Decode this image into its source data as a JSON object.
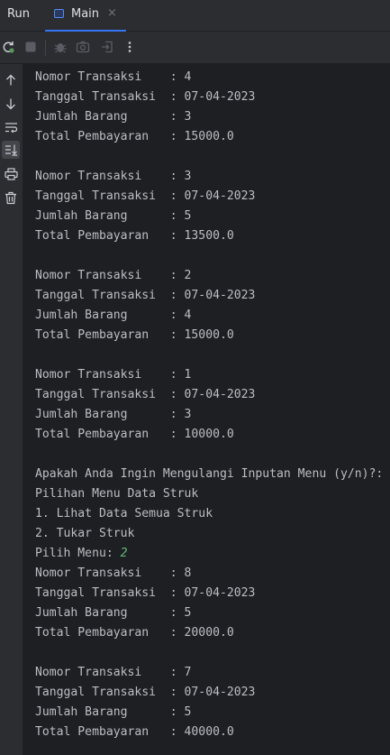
{
  "tabbar": {
    "run_label": "Run",
    "tab_label": "Main",
    "close_glyph": "×"
  },
  "toolbar": {
    "buttons": [
      "rerun-icon",
      "stop-icon",
      "debug-icon",
      "screenshot-icon",
      "exit-icon",
      "more-icon"
    ]
  },
  "sidebar": {
    "buttons": [
      "arrow-up-icon",
      "arrow-down-icon",
      "soft-wrap-icon",
      "scroll-to-end-icon",
      "print-icon",
      "trash-icon"
    ]
  },
  "colors": {
    "accent": "#3574f0",
    "console_text": "#bcbec4",
    "user_input": "#5fb87a",
    "background": "#1e1f22",
    "panel": "#2b2d30"
  },
  "console": {
    "lines": [
      {
        "text": "Nomor Transaksi    : 4"
      },
      {
        "text": "Tanggal Transaksi  : 07-04-2023"
      },
      {
        "text": "Jumlah Barang      : 3"
      },
      {
        "text": "Total Pembayaran   : 15000.0"
      },
      {
        "text": ""
      },
      {
        "text": "Nomor Transaksi    : 3"
      },
      {
        "text": "Tanggal Transaksi  : 07-04-2023"
      },
      {
        "text": "Jumlah Barang      : 5"
      },
      {
        "text": "Total Pembayaran   : 13500.0"
      },
      {
        "text": ""
      },
      {
        "text": "Nomor Transaksi    : 2"
      },
      {
        "text": "Tanggal Transaksi  : 07-04-2023"
      },
      {
        "text": "Jumlah Barang      : 4"
      },
      {
        "text": "Total Pembayaran   : 15000.0"
      },
      {
        "text": ""
      },
      {
        "text": "Nomor Transaksi    : 1"
      },
      {
        "text": "Tanggal Transaksi  : 07-04-2023"
      },
      {
        "text": "Jumlah Barang      : 3"
      },
      {
        "text": "Total Pembayaran   : 10000.0"
      },
      {
        "text": ""
      },
      {
        "text": "Apakah Anda Ingin Mengulangi Inputan Menu (y/n)?:"
      },
      {
        "text": "Pilihan Menu Data Struk"
      },
      {
        "text": "1. Lihat Data Semua Struk"
      },
      {
        "text": "2. Tukar Struk"
      },
      {
        "text": "Pilih Menu: ",
        "input": "2"
      },
      {
        "text": "Nomor Transaksi    : 8"
      },
      {
        "text": "Tanggal Transaksi  : 07-04-2023"
      },
      {
        "text": "Jumlah Barang      : 5"
      },
      {
        "text": "Total Pembayaran   : 20000.0"
      },
      {
        "text": ""
      },
      {
        "text": "Nomor Transaksi    : 7"
      },
      {
        "text": "Tanggal Transaksi  : 07-04-2023"
      },
      {
        "text": "Jumlah Barang      : 5"
      },
      {
        "text": "Total Pembayaran   : 40000.0"
      }
    ]
  }
}
